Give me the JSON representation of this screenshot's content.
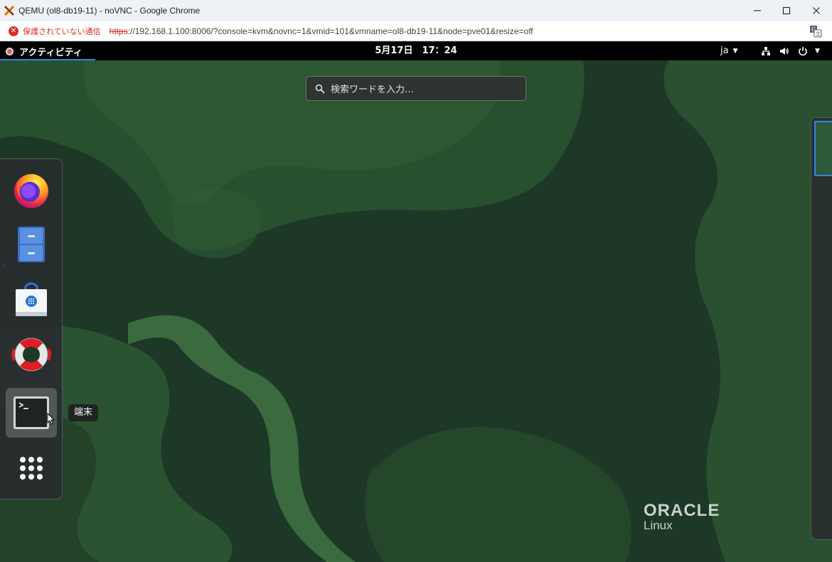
{
  "browser": {
    "window_title": "QEMU (ol8-db19-11) - noVNC - Google Chrome",
    "security_label": "保護されていない通信",
    "url_scheme": "https",
    "url_rest": "://192.168.1.100:8006/?console=kvm&novnc=1&vmid=101&vmname=ol8-db19-11&node=pve01&resize=off"
  },
  "gnome": {
    "activities_label": "アクティビティ",
    "clock": "5月17日　17：24",
    "language": "ja"
  },
  "overview": {
    "search_placeholder": "検索ワードを入力…",
    "dash_items": [
      {
        "name": "firefox",
        "icon": "firefox-icon"
      },
      {
        "name": "files",
        "icon": "file-cabinet-icon"
      },
      {
        "name": "software",
        "icon": "software-bag-icon"
      },
      {
        "name": "help",
        "icon": "lifebuoy-icon"
      },
      {
        "name": "terminal",
        "icon": "terminal-icon",
        "active": true
      },
      {
        "name": "show-applications",
        "icon": "app-grid-icon"
      }
    ],
    "tooltip": "端末"
  },
  "branding": {
    "line1": "ORACLE",
    "line2": "Linux"
  }
}
